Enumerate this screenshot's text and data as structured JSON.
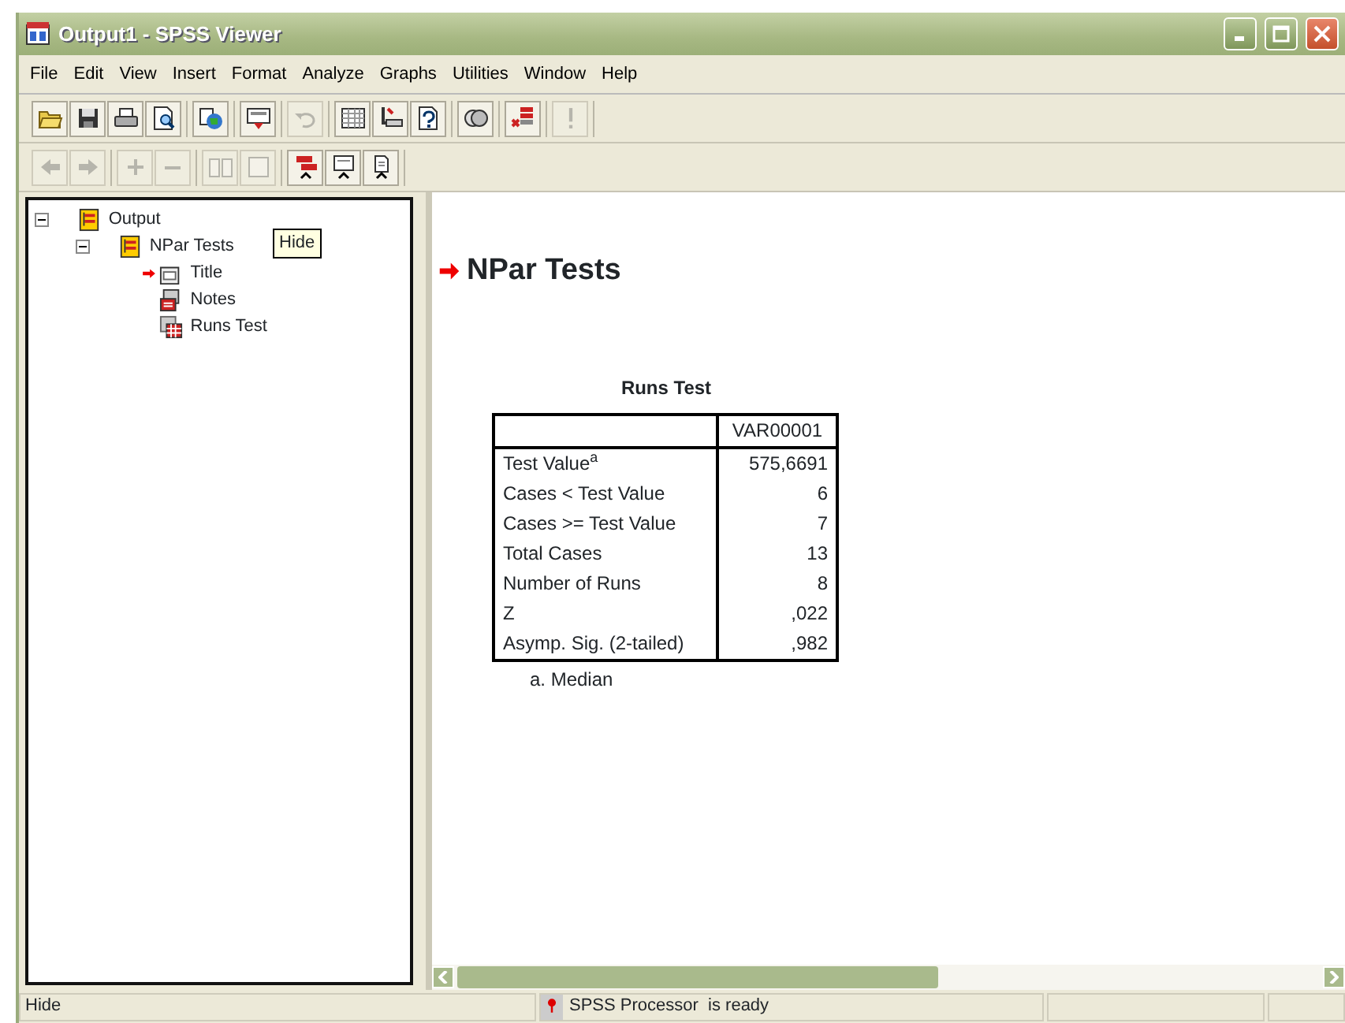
{
  "window": {
    "title": "Output1 - SPSS Viewer"
  },
  "menu": [
    "File",
    "Edit",
    "View",
    "Insert",
    "Format",
    "Analyze",
    "Graphs",
    "Utilities",
    "Window",
    "Help"
  ],
  "toolbar_1": [
    [
      {
        "kind": "open",
        "disabled": false
      },
      {
        "kind": "save",
        "disabled": false
      },
      {
        "kind": "print",
        "disabled": false
      },
      {
        "kind": "preview",
        "disabled": false
      }
    ],
    [
      {
        "kind": "globe",
        "disabled": false
      }
    ],
    [
      {
        "kind": "dialog",
        "disabled": false
      }
    ],
    [
      {
        "kind": "undo",
        "disabled": true
      }
    ],
    [
      {
        "kind": "grid",
        "disabled": false
      },
      {
        "kind": "insert",
        "disabled": false
      },
      {
        "kind": "info",
        "disabled": false
      }
    ],
    [
      {
        "kind": "circles",
        "disabled": false
      }
    ],
    [
      {
        "kind": "stack",
        "disabled": false
      }
    ],
    [
      {
        "kind": "exclaim",
        "disabled": true
      }
    ]
  ],
  "toolbar_2": [
    [
      {
        "kind": "back",
        "disabled": true
      },
      {
        "kind": "forward",
        "disabled": true
      }
    ],
    [
      {
        "kind": "plus",
        "disabled": true
      },
      {
        "kind": "minus",
        "disabled": true
      }
    ],
    [
      {
        "kind": "book",
        "disabled": true
      },
      {
        "kind": "page",
        "disabled": true
      }
    ],
    [
      {
        "kind": "promote",
        "disabled": false
      },
      {
        "kind": "slide",
        "disabled": false
      },
      {
        "kind": "doc",
        "disabled": false
      }
    ]
  ],
  "outline": [
    {
      "label": "Output",
      "kind": "book",
      "expanded": true,
      "current": false,
      "children": [
        {
          "label": "NPar Tests",
          "kind": "book",
          "expanded": true,
          "current": false,
          "children": [
            {
              "label": "Title",
              "kind": "title",
              "current": true
            },
            {
              "label": "Notes",
              "kind": "notes",
              "current": false
            },
            {
              "label": "Runs Test",
              "kind": "table",
              "current": false
            }
          ]
        }
      ]
    }
  ],
  "tooltip": "Hide",
  "output": {
    "heading": "NPar Tests",
    "table": {
      "caption": "Runs Test",
      "columns": [
        "",
        "VAR00001"
      ],
      "rows": [
        [
          "Test Value$^{a}$",
          "575,6691"
        ],
        [
          "Cases < Test Value",
          "6"
        ],
        [
          "Cases >= Test Value",
          "7"
        ],
        [
          "Total Cases",
          "13"
        ],
        [
          "Number of Runs",
          "8"
        ],
        [
          "Z",
          ",022"
        ],
        [
          "Asymp. Sig. (2-tailed)",
          ",982"
        ]
      ],
      "footnote": "a. Median"
    }
  },
  "status_bar": {
    "message": "Hide",
    "processor": "SPSS Processor  is ready"
  }
}
